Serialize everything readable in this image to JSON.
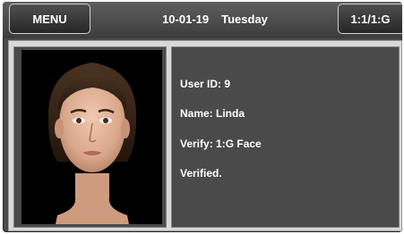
{
  "header": {
    "menu_label": "MENU",
    "date": "10-01-19",
    "day": "Tuesday",
    "mode_label": "1:1/1:G"
  },
  "result": {
    "user_id": "User ID: 9",
    "name": "Name: Linda",
    "verify": "Verify: 1:G Face",
    "status": "Verified."
  },
  "colors": {
    "background": "#4a4a4a",
    "text": "#ffffff",
    "photo_background": "#000000"
  }
}
